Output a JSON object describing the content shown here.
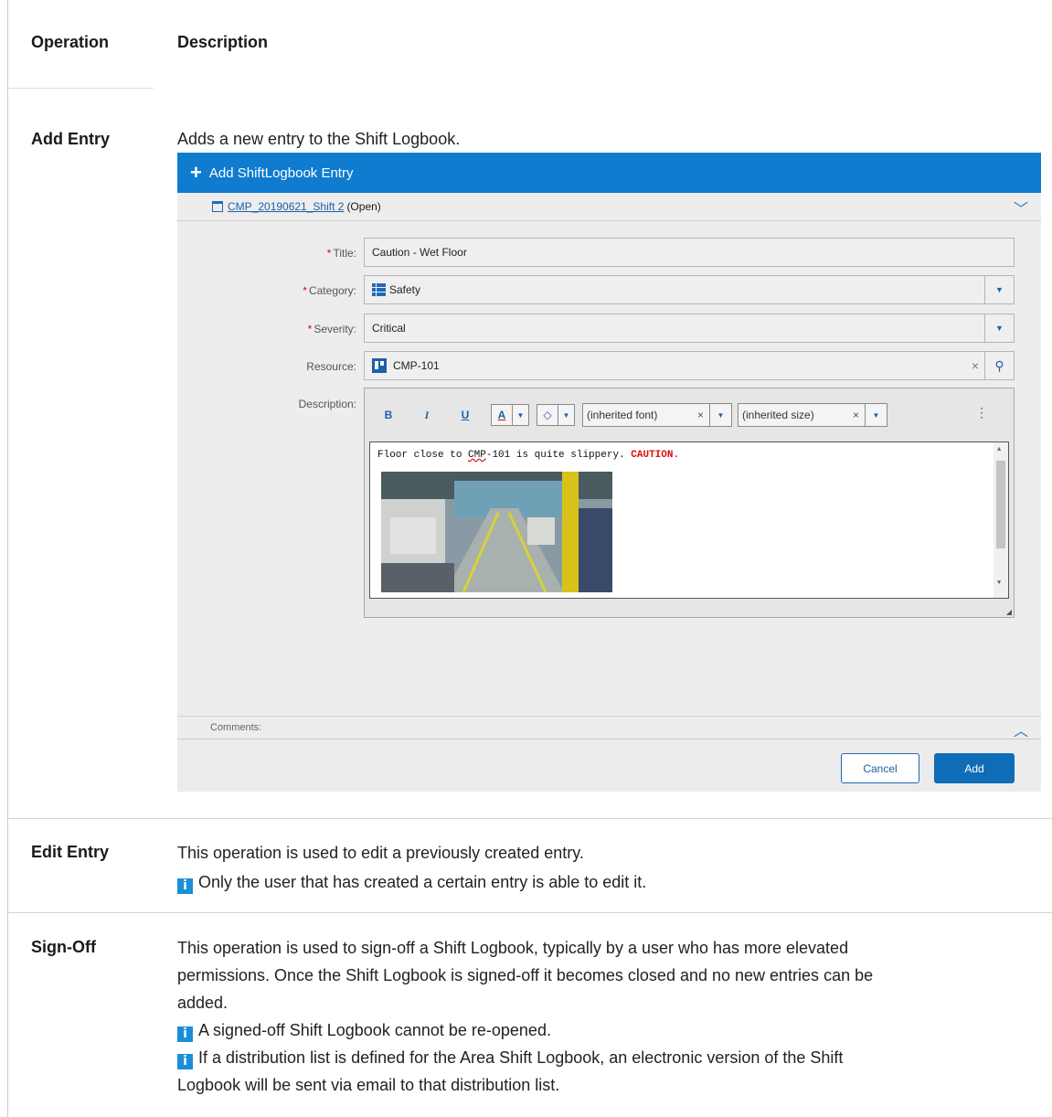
{
  "table": {
    "header": {
      "operation": "Operation",
      "description": "Description"
    },
    "add_entry": {
      "operation": "Add Entry",
      "description": "Adds a new entry to the Shift Logbook."
    },
    "edit_entry": {
      "operation": "Edit Entry",
      "description": "This operation is used to edit a previously created entry.",
      "note": "Only the user that has created a certain entry is able to edit it."
    },
    "sign_off": {
      "operation": "Sign-Off",
      "description_line1": "This operation is used to sign-off a Shift Logbook, typically by a user who has more elevated",
      "description_line2": "permissions. Once the Shift Logbook is signed-off it becomes closed and no new entries can be",
      "description_line3": "added.",
      "note1": "A signed-off Shift Logbook cannot be re-opened.",
      "note2_line1": "If a distribution list is defined for the Area Shift Logbook, an electronic version of the Shift",
      "note2_line2": "Logbook will be sent via email to that distribution list."
    }
  },
  "dialog": {
    "title": "Add ShiftLogbook Entry",
    "shift_link": "CMP_20190621_Shift 2",
    "shift_status": "(Open)",
    "fields": {
      "title_label": "Title:",
      "title_value": "Caution - Wet Floor",
      "category_label": "Category:",
      "category_value": "Safety",
      "severity_label": "Severity:",
      "severity_value": "Critical",
      "resource_label": "Resource:",
      "resource_value": "CMP-101",
      "description_label": "Description:"
    },
    "editor": {
      "bold": "B",
      "italic": "I",
      "underline": "U",
      "font_color": "A",
      "font_combo": "(inherited font)",
      "size_combo": "(inherited size)",
      "text_before": "Floor close to ",
      "text_link": "CMP",
      "text_after": "-101 is quite slippery. ",
      "text_caution": "CAUTION."
    },
    "comments_label": "Comments:",
    "cancel_label": "Cancel",
    "add_label": "Add"
  },
  "colors": {
    "accent": "#0f7ccf",
    "info_icon": "#1a8fd8",
    "required": "#d01010"
  }
}
